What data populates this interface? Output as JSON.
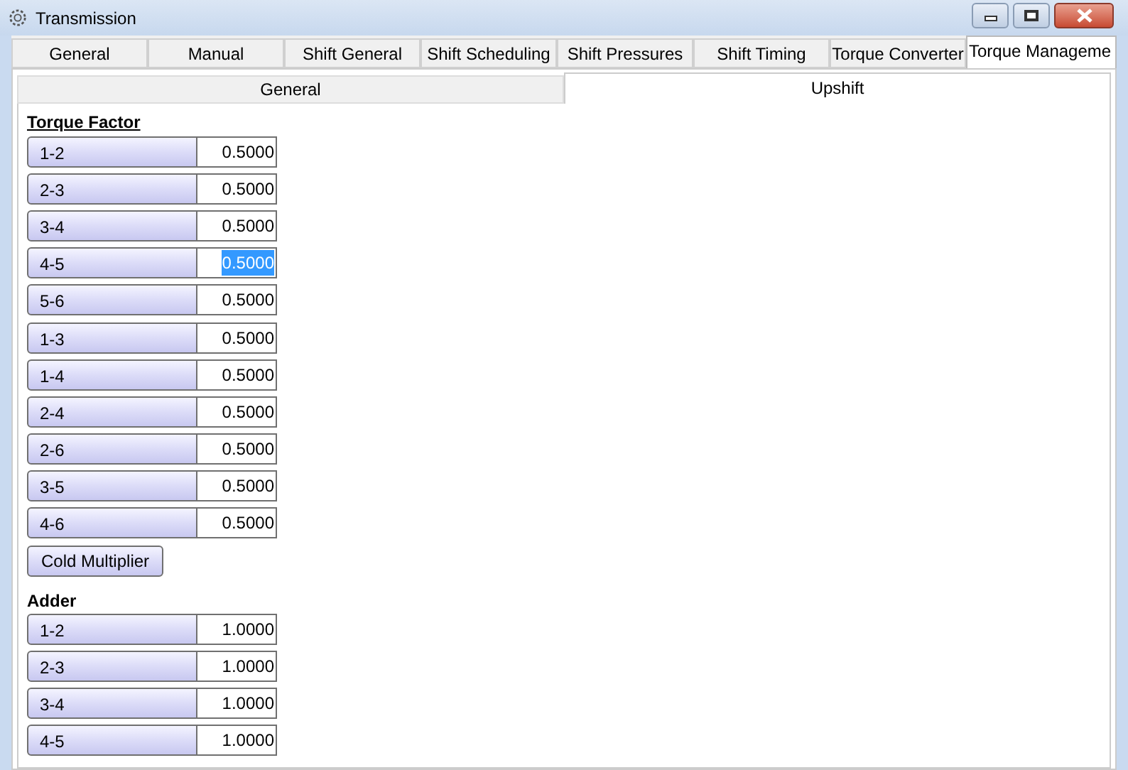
{
  "window": {
    "title": "Transmission"
  },
  "tabs": [
    {
      "label": "General",
      "selected": false
    },
    {
      "label": "Manual",
      "selected": false
    },
    {
      "label": "Shift General",
      "selected": false
    },
    {
      "label": "Shift Scheduling",
      "selected": false
    },
    {
      "label": "Shift Pressures",
      "selected": false
    },
    {
      "label": "Shift Timing",
      "selected": false
    },
    {
      "label": "Torque Converter",
      "selected": false
    },
    {
      "label": "Torque Manageme",
      "selected": true
    }
  ],
  "subtabs": [
    {
      "label": "General",
      "selected": false
    },
    {
      "label": "Upshift",
      "selected": true
    }
  ],
  "torque_factor": {
    "title": "Torque Factor",
    "groups": [
      {
        "rows": [
          {
            "label": "1-2",
            "value": "0.5000",
            "selected": false
          },
          {
            "label": "2-3",
            "value": "0.5000",
            "selected": false
          },
          {
            "label": "3-4",
            "value": "0.5000",
            "selected": false
          },
          {
            "label": "4-5",
            "value": "0.5000",
            "selected": true
          },
          {
            "label": "5-6",
            "value": "0.5000",
            "selected": false
          }
        ]
      },
      {
        "rows": [
          {
            "label": "1-3",
            "value": "0.5000",
            "selected": false
          },
          {
            "label": "1-4",
            "value": "0.5000",
            "selected": false
          },
          {
            "label": "2-4",
            "value": "0.5000",
            "selected": false
          },
          {
            "label": "2-6",
            "value": "0.5000",
            "selected": false
          },
          {
            "label": "3-5",
            "value": "0.5000",
            "selected": false
          },
          {
            "label": "4-6",
            "value": "0.5000",
            "selected": false
          }
        ]
      }
    ]
  },
  "cold_multiplier_button": "Cold Multiplier",
  "adder": {
    "title": "Adder",
    "rows": [
      {
        "label": "1-2",
        "value": "1.0000",
        "selected": false
      },
      {
        "label": "2-3",
        "value": "1.0000",
        "selected": false
      },
      {
        "label": "3-4",
        "value": "1.0000",
        "selected": false
      },
      {
        "label": "4-5",
        "value": "1.0000",
        "selected": false
      }
    ]
  }
}
